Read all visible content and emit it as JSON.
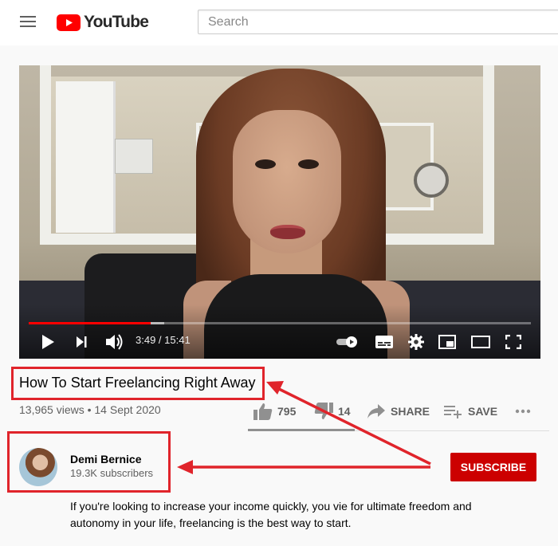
{
  "header": {
    "logo_text": "YouTube",
    "search_placeholder": "Search"
  },
  "player": {
    "current_time": "3:49",
    "duration": "15:41",
    "time_display": "3:49 / 15:41",
    "progress_fraction": 0.2434,
    "buffered_fraction": 0.27
  },
  "video": {
    "title": "How To Start Freelancing Right Away",
    "meta": "13,965 views • 14 Sept 2020",
    "like_count": "795",
    "dislike_count": "14",
    "share_label": "SHARE",
    "save_label": "SAVE"
  },
  "channel": {
    "name": "Demi Bernice",
    "subscribers": "19.3K subscribers",
    "subscribe_label": "SUBSCRIBE"
  },
  "description": "If you're looking to increase your income quickly, you vie for ultimate freedom and autonomy in your life, freelancing is the best way to start.",
  "colors": {
    "brand_red": "#ff0000",
    "subscribe_red": "#cc0000",
    "annotation_red": "#e0242b"
  }
}
